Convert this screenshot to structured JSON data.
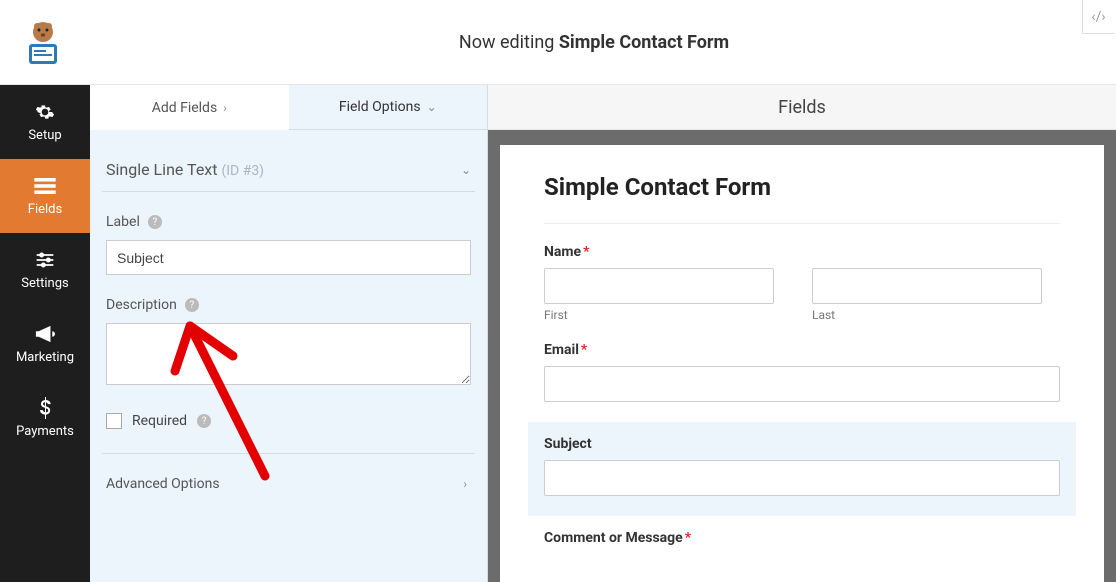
{
  "header": {
    "editing_prefix": "Now editing",
    "form_name": "Simple Contact Form"
  },
  "sidebar": {
    "items": [
      {
        "label": "Setup"
      },
      {
        "label": "Fields"
      },
      {
        "label": "Settings"
      },
      {
        "label": "Marketing"
      },
      {
        "label": "Payments"
      }
    ]
  },
  "panel": {
    "tabs": {
      "add": "Add Fields",
      "options": "Field Options"
    },
    "field": {
      "type": "Single Line Text",
      "id_text": "(ID #3)",
      "label_caption": "Label",
      "label_value": "Subject",
      "description_caption": "Description",
      "description_value": "",
      "required_caption": "Required",
      "advanced_caption": "Advanced Options"
    }
  },
  "preview": {
    "section_title": "Fields",
    "form_title": "Simple Contact Form",
    "fields": {
      "name_label": "Name",
      "first_sub": "First",
      "last_sub": "Last",
      "email_label": "Email",
      "subject_label": "Subject",
      "comment_label": "Comment or Message"
    }
  }
}
